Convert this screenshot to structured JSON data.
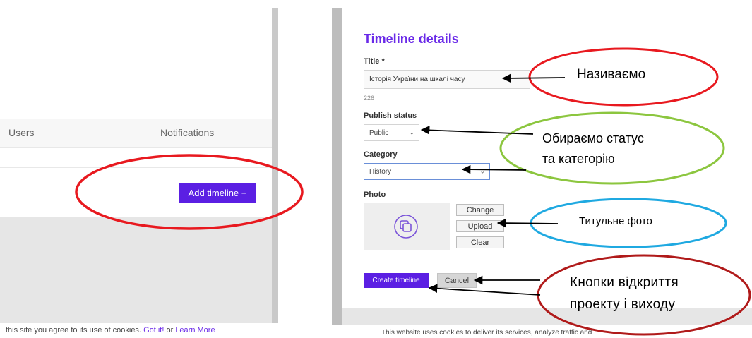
{
  "left_panel": {
    "columns": {
      "users": "Users",
      "notifications": "Notifications"
    },
    "add_button": "Add timeline +",
    "cookie": {
      "prefix": "this site you agree to its use of cookies.",
      "got_it": "Got it!",
      "or": "or",
      "learn_more": "Learn More"
    }
  },
  "right_panel": {
    "heading": "Timeline details",
    "title_field": {
      "label": "Title *",
      "value": "Історія України на шкалі часу",
      "char_count": "226"
    },
    "publish_status": {
      "label": "Publish status",
      "value": "Public"
    },
    "category": {
      "label": "Category",
      "value": "History"
    },
    "photo": {
      "label": "Photo",
      "change": "Change",
      "upload": "Upload",
      "clear": "Clear"
    },
    "buttons": {
      "create": "Create timeline",
      "cancel": "Cancel"
    },
    "cookie": "This website uses cookies to deliver its services, analyze traffic and"
  },
  "annotations": {
    "name": "Називаємо",
    "status_1": "Обираємо статус",
    "status_2": "та категорію",
    "photo": "Титульне фото",
    "buttons_1": "Кнопки відкриття",
    "buttons_2": "проекту і виходу"
  },
  "colors": {
    "accent_purple": "#5b1fe3",
    "heading_purple": "#6a2ae8",
    "ellipse_red": "#e8191f",
    "ellipse_green": "#8cc63f",
    "ellipse_blue": "#1fa9e1",
    "ellipse_dark_red": "#b01a1a"
  },
  "icons": {
    "photo_placeholder": "copy-squares-icon",
    "select_arrow": "chevron-down-icon"
  }
}
